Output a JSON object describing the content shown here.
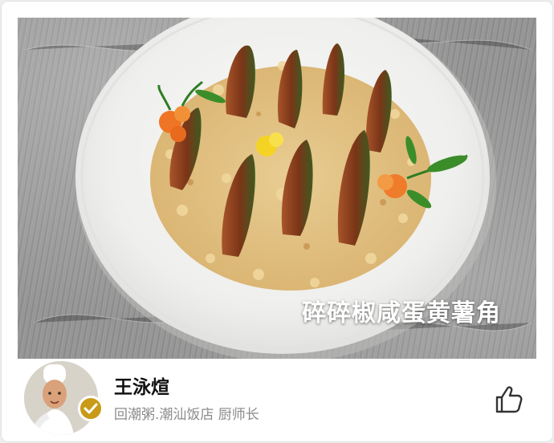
{
  "post": {
    "dish_name": "碎碎椒咸蛋黄薯角",
    "photo_alt": "dish-photo"
  },
  "chef": {
    "name": "王泳煊",
    "title": "回潮粥.潮汕饭店 厨师长",
    "verified": true,
    "badge_color": "#c99a17"
  },
  "actions": {
    "like_icon": "thumbs-up-icon"
  }
}
